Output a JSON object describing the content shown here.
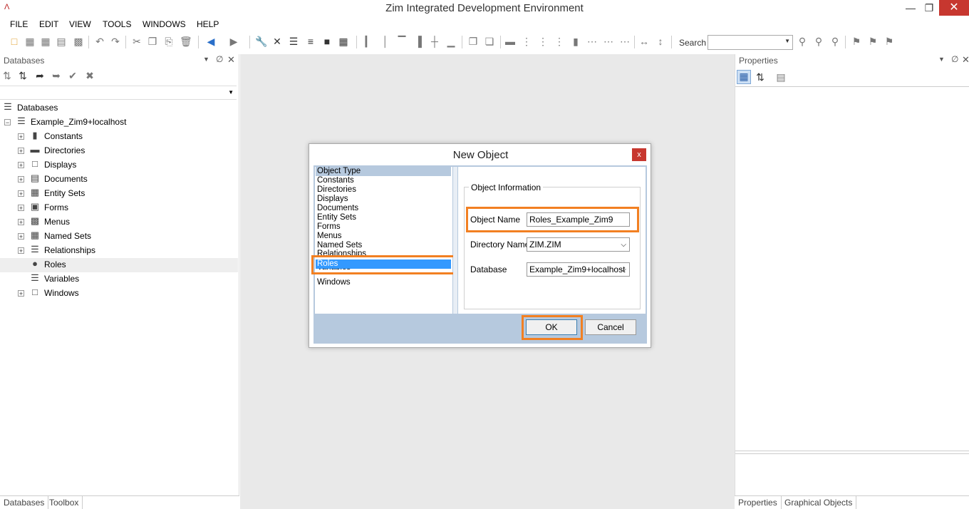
{
  "window": {
    "title": "Zim Integrated Development Environment",
    "minimize": "—",
    "restore": "❐",
    "close": "✕"
  },
  "menu": [
    "FILE",
    "EDIT",
    "VIEW",
    "TOOLS",
    "WINDOWS",
    "HELP"
  ],
  "toolbar": {
    "search_label": "Search",
    "search_value": ""
  },
  "databases_panel": {
    "title": "Databases",
    "filter_value": "",
    "root": "Databases",
    "connection": "Example_Zim9+localhost",
    "items": [
      "Constants",
      "Directories",
      "Displays",
      "Documents",
      "Entity Sets",
      "Forms",
      "Menus",
      "Named Sets",
      "Relationships",
      "Roles",
      "Variables",
      "Windows"
    ]
  },
  "properties_panel": {
    "title": "Properties"
  },
  "bottom_tabs_left": [
    "Databases",
    "Toolbox"
  ],
  "bottom_tabs_right": [
    "Properties",
    "Graphical Objects"
  ],
  "dialog": {
    "title": "New Object",
    "close_glyph": "x",
    "list_header": "Object Type",
    "object_types": [
      "Constants",
      "Directories",
      "Displays",
      "Documents",
      "Entity Sets",
      "Forms",
      "Menus",
      "Named Sets",
      "Relationships",
      "Roles",
      "Variables",
      "Windows"
    ],
    "selected_type": "Roles",
    "info_legend": "Object Information",
    "object_name_label": "Object Name",
    "object_name_value": "Roles_Example_Zim9",
    "directory_name_label": "Directory Name",
    "directory_name_value": "ZIM.ZIM",
    "database_label": "Database",
    "database_value": "Example_Zim9+localhost",
    "ok_label": "OK",
    "cancel_label": "Cancel"
  },
  "colors": {
    "highlight": "#f28022",
    "selection": "#3399ff",
    "dialog_band": "#b6c9de",
    "close_red": "#c7372f"
  }
}
